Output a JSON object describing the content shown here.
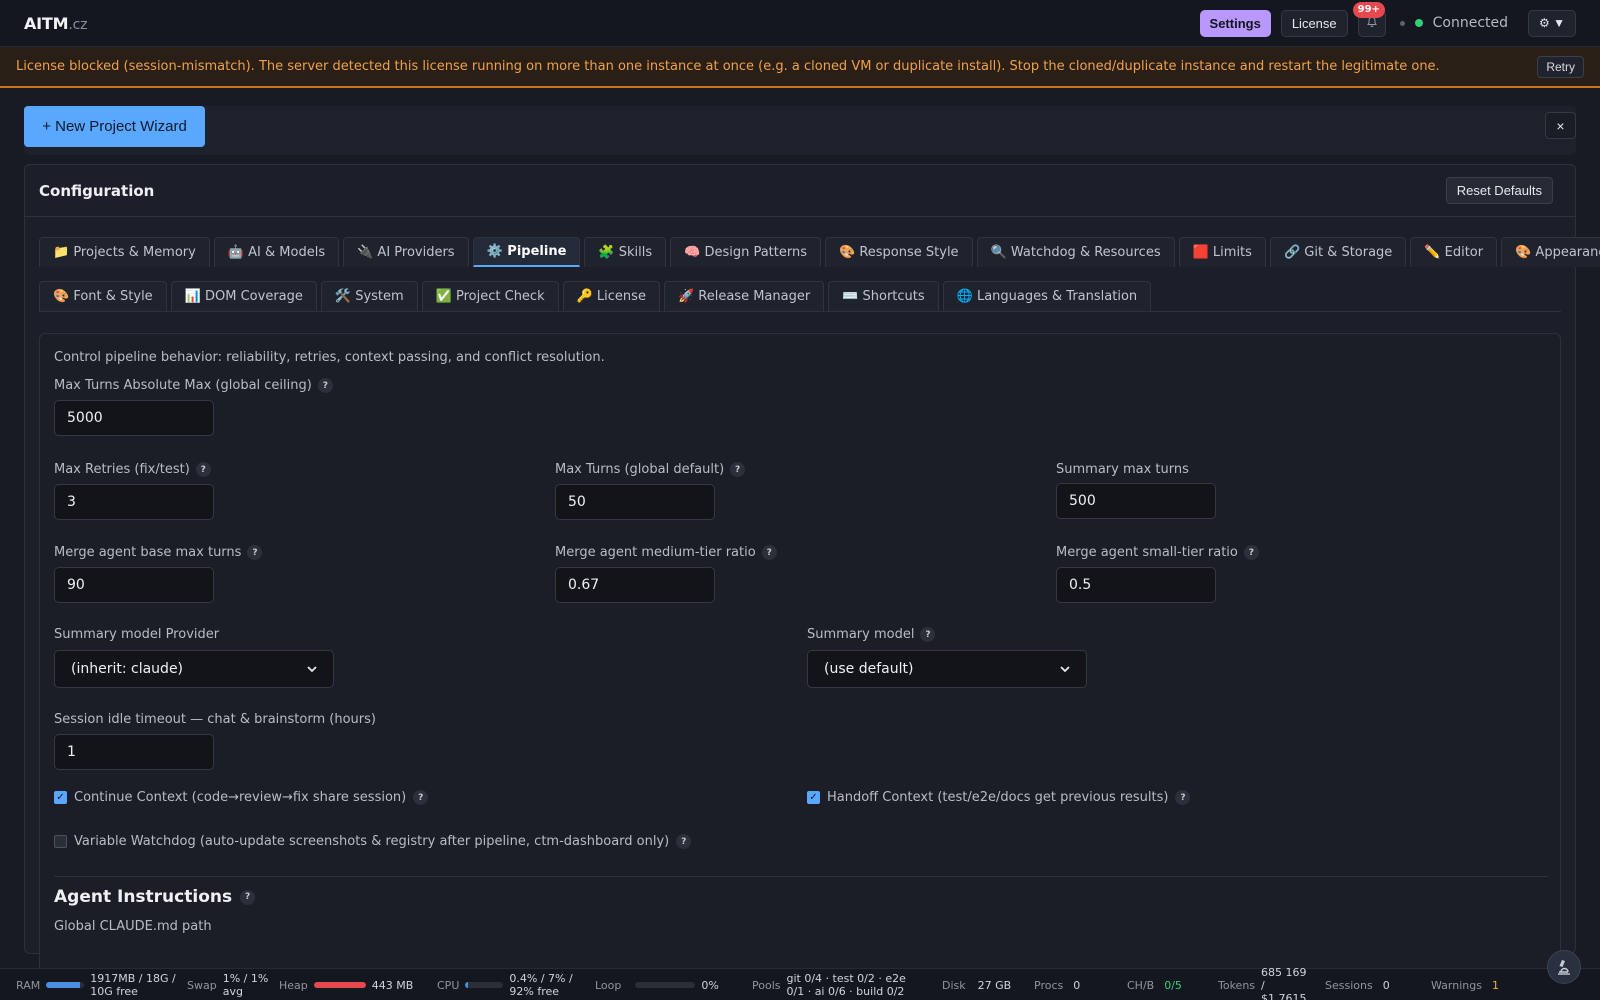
{
  "header": {
    "logo_main": "AITM",
    "logo_tld": ".cz",
    "settings_label": "Settings",
    "license_label": "License",
    "notif_badge": "99+",
    "connection_label": "Connected",
    "menu_label": "⚙ ▼"
  },
  "banner": {
    "text": "License blocked (session-mismatch). The server detected this license running on more than one instance at once (e.g. a cloned VM or duplicate install). Stop the cloned/duplicate instance and restart the legitimate one.",
    "retry_label": "Retry"
  },
  "wizard": {
    "button_label": "+ New Project Wizard",
    "close_label": "×"
  },
  "config": {
    "title": "Configuration",
    "reset_label": "Reset Defaults",
    "tabs_row1": [
      {
        "label": "📁 Projects & Memory",
        "active": false
      },
      {
        "label": "🤖 AI & Models",
        "active": false
      },
      {
        "label": "🔌 AI Providers",
        "active": false
      },
      {
        "label": "⚙️ Pipeline",
        "active": true
      },
      {
        "label": "🧩 Skills",
        "active": false
      },
      {
        "label": "🧠 Design Patterns",
        "active": false
      },
      {
        "label": "🎨 Response Style",
        "active": false
      },
      {
        "label": "🔍 Watchdog & Resources",
        "active": false
      },
      {
        "label": "🟥 Limits",
        "active": false
      },
      {
        "label": "🔗 Git & Storage",
        "active": false
      },
      {
        "label": "✏️ Editor",
        "active": false
      },
      {
        "label": "🎨 Appearance",
        "active": false
      }
    ],
    "tabs_row2": [
      {
        "label": "🎨 Font & Style",
        "active": false
      },
      {
        "label": "📊 DOM Coverage",
        "active": false
      },
      {
        "label": "🛠️ System",
        "active": false
      },
      {
        "label": "✅ Project Check",
        "active": false
      },
      {
        "label": "🔑 License",
        "active": false
      },
      {
        "label": "🚀 Release Manager",
        "active": false
      },
      {
        "label": "⌨️ Shortcuts",
        "active": false
      },
      {
        "label": "🌐 Languages & Translation",
        "active": false
      }
    ]
  },
  "pipeline": {
    "description": "Control pipeline behavior: reliability, retries, context passing, and conflict resolution.",
    "help_glyph": "?",
    "max_turns_abs": {
      "label": "Max Turns Absolute Max (global ceiling)",
      "value": "5000"
    },
    "max_retries": {
      "label": "Max Retries (fix/test)",
      "value": "3"
    },
    "max_turns_default": {
      "label": "Max Turns (global default)",
      "value": "50"
    },
    "summary_max_turns": {
      "label": "Summary max turns",
      "value": "500"
    },
    "merge_base": {
      "label": "Merge agent base max turns",
      "value": "90"
    },
    "merge_medium": {
      "label": "Merge agent medium-tier ratio",
      "value": "0.67"
    },
    "merge_small": {
      "label": "Merge agent small-tier ratio",
      "value": "0.5"
    },
    "summary_provider": {
      "label": "Summary model Provider",
      "value": "(inherit: claude)"
    },
    "summary_model": {
      "label": "Summary model",
      "value": "(use default)"
    },
    "idle_timeout": {
      "label": "Session idle timeout — chat & brainstorm (hours)",
      "value": "1"
    },
    "continue_context": {
      "label": "Continue Context (code→review→fix share session)",
      "checked": true
    },
    "handoff_context": {
      "label": "Handoff Context (test/e2e/docs get previous results)",
      "checked": true
    },
    "variable_watchdog": {
      "label": "Variable Watchdog (auto-update screenshots & registry after pipeline, ctm-dashboard only)",
      "checked": false
    },
    "agent_instructions_title": "Agent Instructions",
    "claude_md_label": "Global CLAUDE.md path"
  },
  "status": {
    "ram": {
      "label": "RAM",
      "value": "1917MB / 18G / 10G free",
      "fill": 0.9,
      "color": "#4a8fe0"
    },
    "swap": {
      "label": "Swap",
      "value": "1% / 1% avg"
    },
    "heap": {
      "label": "Heap",
      "value": "443 MB",
      "fill": 1.0,
      "color": "#e5484d"
    },
    "cpu": {
      "label": "CPU",
      "value": "0.4% / 7% / 92% free",
      "fill": 0.07,
      "color": "#4a8fe0"
    },
    "loop": {
      "label": "Loop",
      "value": "0%",
      "fill": 0.0,
      "color": "#4a8fe0"
    },
    "pools": {
      "label": "Pools",
      "value": "git 0/4 · test 0/2 · e2e 0/1 · ai 0/6 · build 0/2"
    },
    "disk": {
      "label": "Disk",
      "value": "27 GB"
    },
    "procs": {
      "label": "Procs",
      "value": "0"
    },
    "chb": {
      "label": "CH/B",
      "value": "0/5"
    },
    "tokens": {
      "label": "Tokens",
      "value": "685 169 / $1,7615"
    },
    "sessions": {
      "label": "Sessions",
      "value": "0"
    },
    "warnings": {
      "label": "Warnings",
      "value": "1"
    }
  }
}
